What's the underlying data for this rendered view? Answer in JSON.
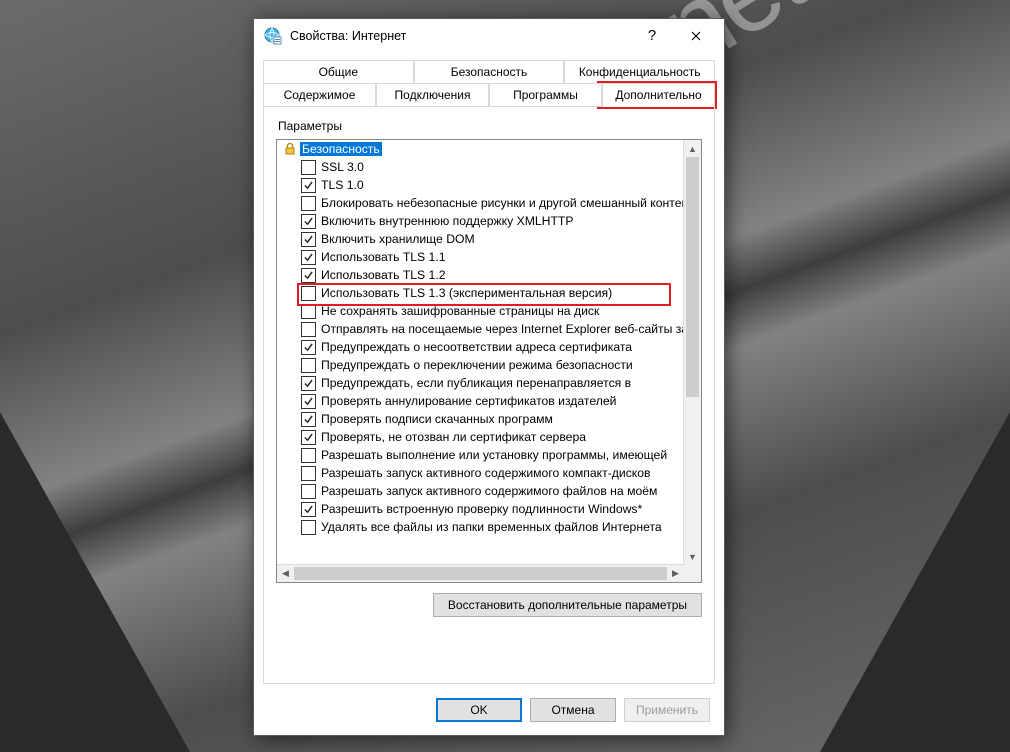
{
  "window": {
    "title": "Свойства: Интернет",
    "help_glyph": "?",
    "close_label": "Close"
  },
  "tabs": {
    "row1": [
      "Общие",
      "Безопасность",
      "Конфиденциальность"
    ],
    "row2": [
      "Содержимое",
      "Подключения",
      "Программы",
      "Дополнительно"
    ],
    "active": "Дополнительно"
  },
  "group_label": "Параметры",
  "tree": {
    "category": "Безопасность",
    "items": [
      {
        "checked": false,
        "label": "SSL 3.0"
      },
      {
        "checked": true,
        "label": "TLS 1.0"
      },
      {
        "checked": false,
        "label": "Блокировать небезопасные рисунки и другой смешанный контент"
      },
      {
        "checked": true,
        "label": "Включить внутреннюю поддержку XMLHTTP"
      },
      {
        "checked": true,
        "label": "Включить хранилище DOM"
      },
      {
        "checked": true,
        "label": "Использовать TLS 1.1"
      },
      {
        "checked": true,
        "label": "Использовать TLS 1.2"
      },
      {
        "checked": false,
        "label": "Использовать TLS 1.3 (экспериментальная версия)",
        "highlight": true
      },
      {
        "checked": false,
        "label": "Не сохранять зашифрованные страницы на диск"
      },
      {
        "checked": false,
        "label": "Отправлять на посещаемые через Internet Explorer веб-сайты запросы"
      },
      {
        "checked": true,
        "label": "Предупреждать о несоответствии адреса сертификата"
      },
      {
        "checked": false,
        "label": "Предупреждать о переключении режима безопасности"
      },
      {
        "checked": true,
        "label": "Предупреждать, если публикация перенаправляется в"
      },
      {
        "checked": true,
        "label": "Проверять аннулирование сертификатов издателей"
      },
      {
        "checked": true,
        "label": "Проверять подписи скачанных программ"
      },
      {
        "checked": true,
        "label": "Проверять, не отозван ли сертификат сервера"
      },
      {
        "checked": false,
        "label": "Разрешать выполнение или установку программы, имеющей"
      },
      {
        "checked": false,
        "label": "Разрешать запуск активного содержимого компакт-дисков"
      },
      {
        "checked": false,
        "label": "Разрешать запуск активного содержимого файлов на моём"
      },
      {
        "checked": true,
        "label": "Разрешить встроенную проверку подлинности Windows*"
      },
      {
        "checked": false,
        "label": "Удалять все файлы из папки временных файлов Интернета"
      }
    ]
  },
  "restore_button": "Восстановить дополнительные параметры",
  "footer": {
    "ok": "OK",
    "cancel": "Отмена",
    "apply": "Применить"
  },
  "watermark": "spy-soft.net"
}
